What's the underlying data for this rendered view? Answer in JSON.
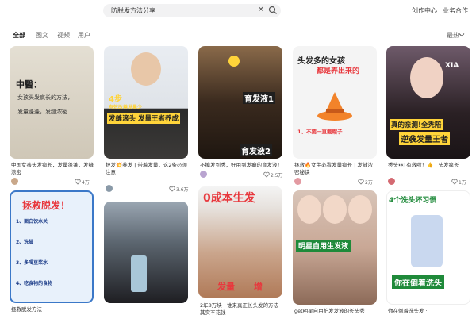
{
  "header": {
    "search_query": "防脱发方法分享",
    "creator_center": "创作中心",
    "business": "业务合作",
    "search_icon": "search-icon",
    "clear_icon": "close-icon"
  },
  "tabs": [
    {
      "label": "全部",
      "active": true
    },
    {
      "label": "图文",
      "active": false
    },
    {
      "label": "视频",
      "active": false
    },
    {
      "label": "用户",
      "active": false
    }
  ],
  "sort_label": "最热",
  "cards": [
    {
      "title": "中国女孩头发疯长，发量蓬蓬，发缝浓密",
      "likes": "4万",
      "overlay": [
        "中醫：",
        "女孩头发疯长的方法，",
        "发量蓬蓬，发缝浓密"
      ]
    },
    {
      "title": "护发💥养发 | 带着发量，这2条必须注意",
      "likes": "3.6万",
      "overlay": [
        "4步",
        "有效改善发量少",
        "发缝滚头 发量王者养成"
      ]
    },
    {
      "title": "不掉发到秃，好用到发癫的育发液！",
      "likes": "2.5万",
      "overlay": [
        "育发液1",
        "育发液2"
      ]
    },
    {
      "title": "拯救🔥女生必看发量疯长 | 发缝浓密秘诀",
      "likes": "2万",
      "overlay": [
        "头发多的女孩",
        "都是养出来的",
        "1、不要一直戴帽子"
      ]
    },
    {
      "title": "秃头👀 有救啦！👍 | 头发疯长",
      "likes": "1万",
      "overlay": [
        "XIA",
        "真的亲测!全秃陪",
        "逆袭发量王者"
      ]
    },
    {
      "title": "拯救脱发方法",
      "likes": "",
      "overlay": [
        "拯救脱发！",
        "1、面白饮水关",
        "2、洗脚",
        "3、多喝豆浆水",
        "4、吃食物的食物"
      ]
    },
    {
      "title": "",
      "likes": "",
      "overlay": []
    },
    {
      "title": "2年8万块 · 谁来真正长头发的方法其实不花钱",
      "likes": "",
      "overlay": [
        "0成本生发",
        "发量",
        "增"
      ]
    },
    {
      "title": "get明星自用护发发液的长头秀",
      "likes": "",
      "overlay": [
        "明星自用生发液"
      ]
    },
    {
      "title": "你在倒着洗头发 ·",
      "likes": "",
      "overlay": [
        "4个洗头坏习惯",
        "你在倒着洗头"
      ]
    }
  ],
  "colors": {
    "accent_red": "#e8383d",
    "banner_green": "#1f8a3a",
    "yellow": "#ffd43a",
    "text_dark": "#333333"
  }
}
